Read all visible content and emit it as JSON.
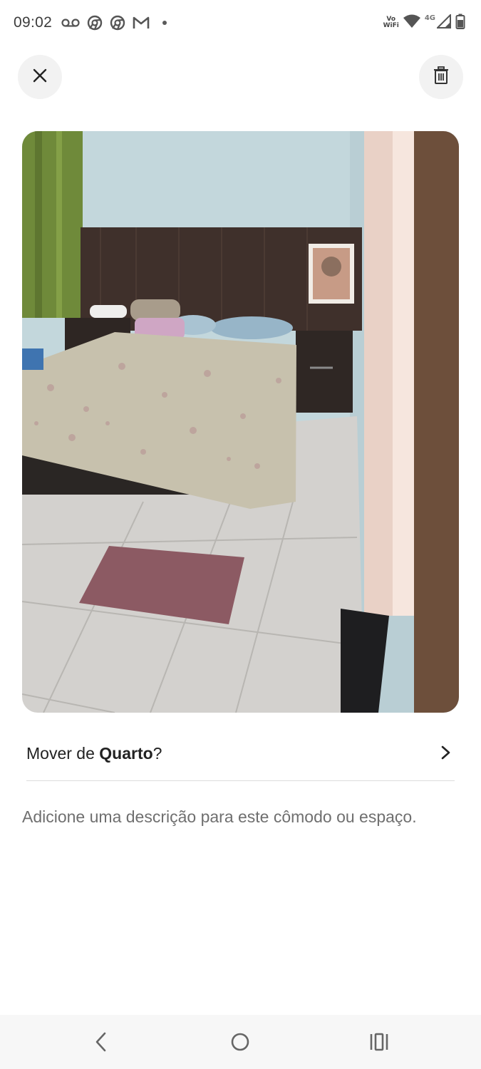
{
  "status_bar": {
    "time": "09:02",
    "left_icons": [
      "voicemail-icon",
      "chrome-icon",
      "chrome-icon",
      "gmail-icon",
      "notification-dot"
    ],
    "vowifi_top": "Vo",
    "vowifi_bottom": "WiFi",
    "network": "4G",
    "right_icons": [
      "vowifi-icon",
      "wifi-icon",
      "signal-icon",
      "battery-icon"
    ]
  },
  "header": {
    "close_icon": "close-icon",
    "delete_icon": "trash-icon"
  },
  "photo": {
    "subject": "bedroom-photo"
  },
  "move_row": {
    "prefix": "Mover de ",
    "room": "Quarto",
    "suffix": "?",
    "icon": "chevron-right-icon"
  },
  "description": {
    "text": "Adicione uma descrição para este cômodo ou espaço."
  },
  "nav_bar": {
    "icons": [
      "back-icon",
      "home-icon",
      "recents-icon"
    ]
  },
  "colors": {
    "text_primary": "#222222",
    "text_secondary": "#6f6f6f",
    "button_bg": "#f2f2f2",
    "divider": "#dddddd"
  }
}
